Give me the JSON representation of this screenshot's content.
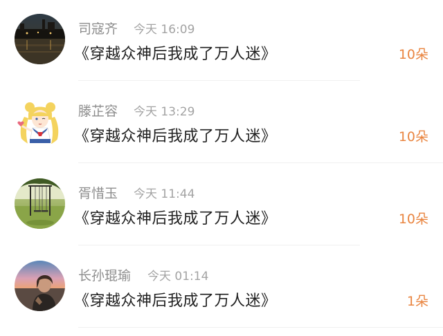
{
  "gift_list": [
    {
      "username": "司寇齐",
      "time": "今天 16:09",
      "title": "《穿越众神后我成了万人迷》",
      "count": "10朵",
      "avatar_icon": "night-river-photo-avatar"
    },
    {
      "username": "滕芷容",
      "time": "今天 13:29",
      "title": "《穿越众神后我成了万人迷》",
      "count": "10朵",
      "avatar_icon": "sailor-moon-cartoon-avatar"
    },
    {
      "username": "胥惜玉",
      "time": "今天 11:44",
      "title": "《穿越众神后我成了万人迷》",
      "count": "10朵",
      "avatar_icon": "park-swing-photo-avatar"
    },
    {
      "username": "长孙琨瑜",
      "time": "今天 01:14",
      "title": "《穿越众神后我成了万人迷》",
      "count": "1朵",
      "avatar_icon": "sunset-person-photo-avatar"
    }
  ],
  "colors": {
    "count_accent": "#e9843f",
    "username": "#8d8d8d",
    "time": "#a3a3a3",
    "title": "#1f1f1f",
    "divider": "#f0f0f0"
  }
}
